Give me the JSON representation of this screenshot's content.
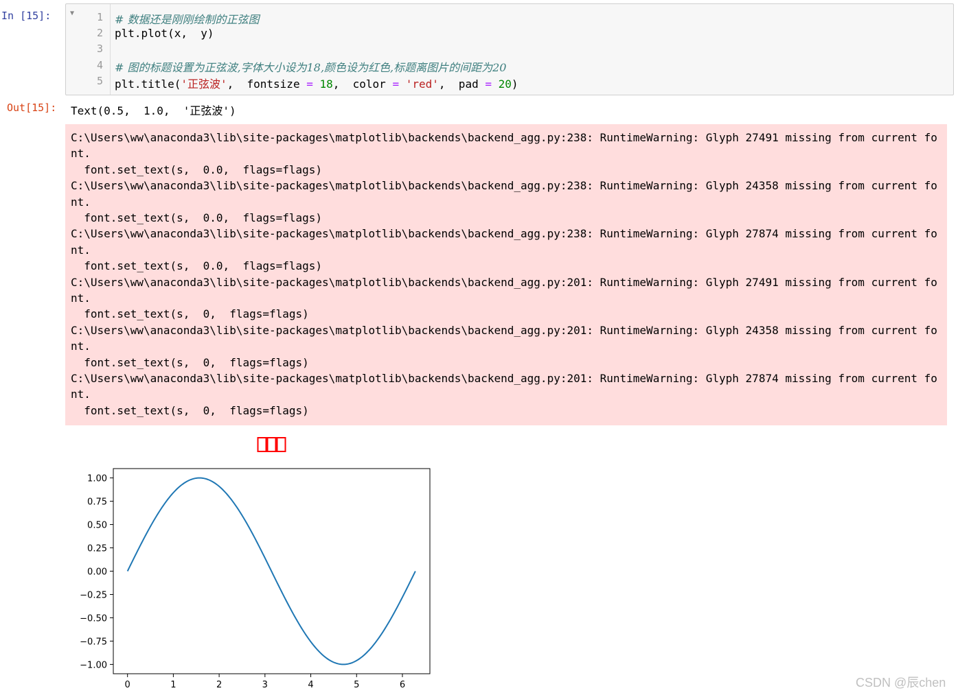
{
  "cell_in": {
    "prompt": "In  [15]:",
    "lines": [
      {
        "no": "1",
        "comment": "# 数据还是刚刚绘制的正弦图"
      },
      {
        "no": "2",
        "code": "plt.plot(x,  y)"
      },
      {
        "no": "3",
        "code": ""
      },
      {
        "no": "4",
        "comment": "# 图的标题设置为正弦波,字体大小设为18,颜色设为红色,标题离图片的间距为20"
      },
      {
        "no": "5",
        "code_parts": [
          "plt.title(",
          "'正弦波'",
          ",  fontsize ",
          "=",
          " ",
          "18",
          ",  color ",
          "=",
          " ",
          "'red'",
          ",  pad ",
          "=",
          " ",
          "20",
          ")"
        ]
      }
    ]
  },
  "cell_out": {
    "prompt": "Out[15]:",
    "result": "Text(0.5,  1.0,  '正弦波')"
  },
  "stderr": {
    "lines": [
      "C:\\Users\\ww\\anaconda3\\lib\\site-packages\\matplotlib\\backends\\backend_agg.py:238: RuntimeWarning: Glyph 27491 missing from current fo",
      "nt.",
      "  font.set_text(s,  0.0,  flags=flags)",
      "C:\\Users\\ww\\anaconda3\\lib\\site-packages\\matplotlib\\backends\\backend_agg.py:238: RuntimeWarning: Glyph 24358 missing from current fo",
      "nt.",
      "  font.set_text(s,  0.0,  flags=flags)",
      "C:\\Users\\ww\\anaconda3\\lib\\site-packages\\matplotlib\\backends\\backend_agg.py:238: RuntimeWarning: Glyph 27874 missing from current fo",
      "nt.",
      "  font.set_text(s,  0.0,  flags=flags)",
      "C:\\Users\\ww\\anaconda3\\lib\\site-packages\\matplotlib\\backends\\backend_agg.py:201: RuntimeWarning: Glyph 27491 missing from current fo",
      "nt.",
      "  font.set_text(s,  0,  flags=flags)",
      "C:\\Users\\ww\\anaconda3\\lib\\site-packages\\matplotlib\\backends\\backend_agg.py:201: RuntimeWarning: Glyph 24358 missing from current fo",
      "nt.",
      "  font.set_text(s,  0,  flags=flags)",
      "C:\\Users\\ww\\anaconda3\\lib\\site-packages\\matplotlib\\backends\\backend_agg.py:201: RuntimeWarning: Glyph 27874 missing from current fo",
      "nt.",
      "  font.set_text(s,  0,  flags=flags)"
    ]
  },
  "chart_data": {
    "type": "line",
    "title_glyphs": 3,
    "title_color": "#ff0000",
    "line_color": "#1f77b4",
    "xlim": [
      -0.31,
      6.6
    ],
    "ylim": [
      -1.1,
      1.1
    ],
    "xticks": [
      0,
      1,
      2,
      3,
      4,
      5,
      6
    ],
    "yticks": [
      1.0,
      0.75,
      0.5,
      0.25,
      0.0,
      -0.25,
      -0.5,
      -0.75,
      -1.0
    ],
    "ytick_labels": [
      "1.00",
      "0.75",
      "0.50",
      "0.25",
      "0.00",
      "−0.25",
      "−0.50",
      "−0.75",
      "−1.00"
    ],
    "xtick_labels": [
      "0",
      "1",
      "2",
      "3",
      "4",
      "5",
      "6"
    ],
    "series": [
      {
        "function": "sin",
        "x_start": 0,
        "x_end": 6.283
      }
    ],
    "grid": false
  },
  "watermark": "CSDN @辰chen"
}
